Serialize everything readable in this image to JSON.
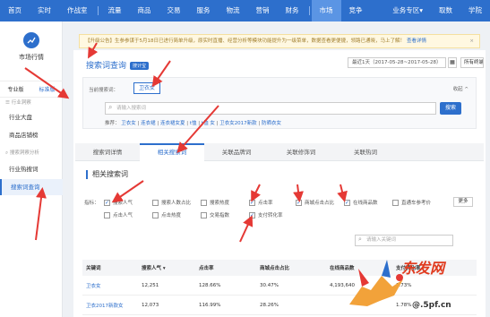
{
  "nav": {
    "items": [
      "首页",
      "实时",
      "作战室",
      "流量",
      "商品",
      "交易",
      "服务",
      "物流",
      "营销",
      "财务",
      "市场",
      "竞争",
      "业务专区",
      "取数",
      "学院"
    ],
    "active": "市场",
    "dropdown_caret": "▾"
  },
  "sidebar": {
    "module_title": "市场行情",
    "module_icon": "chart-icon",
    "versions": [
      "专业版",
      "标准版"
    ],
    "selected_version": "标准版",
    "groups": [
      {
        "label": "行业洞察",
        "items": [
          "行业大盘",
          "商品店铺榜"
        ]
      },
      {
        "label": "搜索洞察分析",
        "items": [
          "行业热搜词",
          "搜索词查询"
        ]
      }
    ],
    "active_item": "搜索词查询"
  },
  "notice": {
    "text": "【升级公告】生参参谋于5月18日已进行简单升级，原实时直播、经营分析等模块功能提升为一级菜单，数据查看更便捷，领路已通晓，马上了解！",
    "link": "查看详情",
    "close": "×"
  },
  "header": {
    "title": "搜索词查询",
    "badge": "搜计宝",
    "date_range": "最近1天（2017-05-28~2017-05-28）",
    "calendar_icon": "calendar-icon",
    "terminal": "所有终端"
  },
  "query": {
    "current_label": "当前搜索词：",
    "current_term": "卫衣女",
    "collapse": "收起 ^",
    "search_placeholder": "请输入搜索词",
    "search_button": "搜索",
    "recommend_label": "推荐：",
    "recommendations": [
      "卫衣女",
      "连衣裙",
      "连衣裙女夏",
      "t恤",
      "t恤 女",
      "卫衣女2017新款",
      "防晒衣女"
    ]
  },
  "tabs": [
    "搜索词详情",
    "相关搜索词",
    "关联品牌词",
    "关联修饰词",
    "关联热词"
  ],
  "active_tab": "相关搜索词",
  "section_title": "相关搜索词",
  "metrics": {
    "label": "指标：",
    "items": [
      {
        "label": "搜索人气",
        "checked": true
      },
      {
        "label": "搜索人数占比",
        "checked": false
      },
      {
        "label": "搜索热度",
        "checked": false
      },
      {
        "label": "点击率",
        "checked": true
      },
      {
        "label": "商城点击占比",
        "checked": true
      },
      {
        "label": "在线商品数",
        "checked": true
      },
      {
        "label": "直通车参考价",
        "checked": false
      },
      {
        "label": "点击人气",
        "checked": false
      },
      {
        "label": "点击热度",
        "checked": false
      },
      {
        "label": "交易指数",
        "checked": false
      },
      {
        "label": "支付转化率",
        "checked": true
      }
    ],
    "more": "更多"
  },
  "keyword_filter_placeholder": "请输入关键词",
  "table": {
    "headers": [
      "关键词",
      "搜索人气 ▾",
      "点击率",
      "商城点击占比",
      "在线商品数",
      "支付转化率"
    ],
    "rows": [
      [
        "卫衣女",
        "12,251",
        "128.66%",
        "30.47%",
        "4,193,640",
        "1.73%"
      ],
      [
        "卫衣2017新款女",
        "12,073",
        "116.99%",
        "28.26%",
        "",
        "1.78%"
      ]
    ]
  },
  "watermark": {
    "text": "东发网",
    "domain": "@.5pf.cn",
    "colors": {
      "red": "#e03a1e",
      "blue": "#2d6fcc"
    }
  }
}
